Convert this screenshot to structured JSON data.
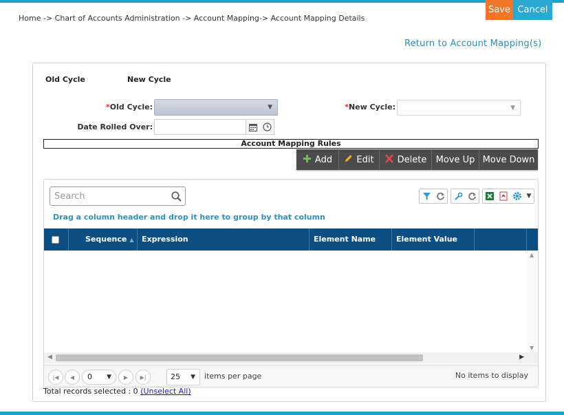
{
  "breadcrumb": "Home -> Chart of Accounts Administration -> Account Mapping-> Account Mapping Details",
  "actions": {
    "save_label": "Save",
    "cancel_label": "Cancel"
  },
  "return_link": "Return to Account Mapping(s)",
  "cycle_tabs": {
    "old": "Old Cycle",
    "new": "New Cycle"
  },
  "form": {
    "required_mark": "*",
    "old_cycle_label": "Old Cycle:",
    "old_cycle_value": "",
    "new_cycle_label": "New Cycle:",
    "new_cycle_value": "",
    "date_label": "Date Rolled Over:",
    "date_value": ""
  },
  "rules_title": "Account Mapping Rules",
  "toolbar": {
    "add": "Add",
    "edit": "Edit",
    "delete": "Delete",
    "move_up": "Move Up",
    "move_down": "Move Down"
  },
  "grid": {
    "search_placeholder": "Search",
    "group_hint": "Drag a column header and drop it here to group by that column",
    "columns": [
      "Sequence",
      "Expression",
      "Element Name",
      "Element Value"
    ],
    "rows": [],
    "pager": {
      "page": "0",
      "page_size": "25",
      "page_size_label": "items per page",
      "empty_message": "No items to display"
    }
  },
  "footer": {
    "total_label": "Total records selected : 0",
    "unselect_label": "(Unselect All)"
  },
  "colors": {
    "accent": "#1ea1c9",
    "save": "#f0772a",
    "cancel": "#2aa8d2",
    "header": "#0e4f83",
    "toolbar": "#4b4b4b"
  }
}
